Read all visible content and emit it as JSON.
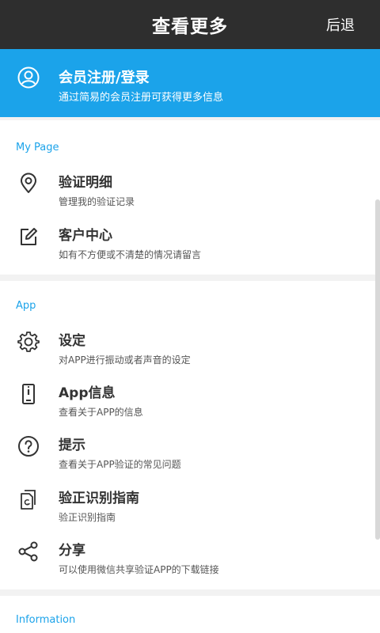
{
  "header": {
    "title": "查看更多",
    "back_label": "后退"
  },
  "banner": {
    "title": "会员注册/登录",
    "subtitle": "通过简易的会员注册可获得更多信息"
  },
  "sections": [
    {
      "title": "My Page",
      "items": [
        {
          "label": "验证明细",
          "desc": "管理我的验证记录",
          "icon": "location-pin-icon"
        },
        {
          "label": "客户中心",
          "desc": "如有不方便或不清楚的情况请留言",
          "icon": "edit-icon"
        }
      ]
    },
    {
      "title": "App",
      "items": [
        {
          "label": "设定",
          "desc": "对APP进行振动或者声音的设定",
          "icon": "gear-icon"
        },
        {
          "label": "App信息",
          "desc": "查看关于APP的信息",
          "icon": "phone-info-icon"
        },
        {
          "label": "提示",
          "desc": "查看关于APP验证的常见问题",
          "icon": "question-icon"
        },
        {
          "label": "验正识别指南",
          "desc": "验正识别指南",
          "icon": "guide-document-icon"
        },
        {
          "label": "分享",
          "desc": "可以使用微信共享验证APP的下载链接",
          "icon": "share-icon"
        }
      ]
    },
    {
      "title": "Information",
      "items": []
    }
  ],
  "colors": {
    "header_bg": "#2e2e2e",
    "accent": "#1ba3ea",
    "background": "#f2f2f2"
  }
}
